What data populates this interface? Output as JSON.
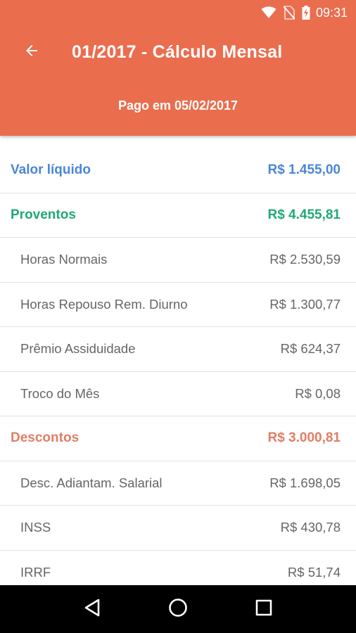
{
  "status_bar": {
    "time": "09:31",
    "icons": [
      "wifi-icon",
      "no-sim-icon",
      "battery-charging-icon"
    ]
  },
  "toolbar": {
    "back_icon": "arrow-back-icon",
    "title": "01/2017 - Cálculo Mensal"
  },
  "subtitle": "Pago em 05/02/2017",
  "colors": {
    "header": "#ea6d4e",
    "valor_liquido": "#4a86d8",
    "proventos": "#1fa974",
    "descontos": "#e07e63"
  },
  "summary": {
    "liquido": {
      "label": "Valor líquido",
      "value": "R$ 1.455,00"
    },
    "proventos": {
      "label": "Proventos",
      "value": "R$ 4.455,81"
    },
    "descontos": {
      "label": "Descontos",
      "value": "R$ 3.000,81"
    }
  },
  "proventos_items": [
    {
      "label": "Horas Normais",
      "value": "R$ 2.530,59"
    },
    {
      "label": "Horas Repouso Rem. Diurno",
      "value": "R$ 1.300,77"
    },
    {
      "label": "Prêmio Assiduidade",
      "value": "R$ 624,37"
    },
    {
      "label": "Troco do Mês",
      "value": "R$ 0,08"
    }
  ],
  "descontos_items": [
    {
      "label": "Desc. Adiantam. Salarial",
      "value": "R$ 1.698,05"
    },
    {
      "label": "INSS",
      "value": "R$ 430,78"
    },
    {
      "label": "IRRF",
      "value": "R$ 51,74"
    }
  ],
  "nav_bar": {
    "buttons": [
      "back-triangle-icon",
      "home-circle-icon",
      "recents-square-icon"
    ]
  }
}
